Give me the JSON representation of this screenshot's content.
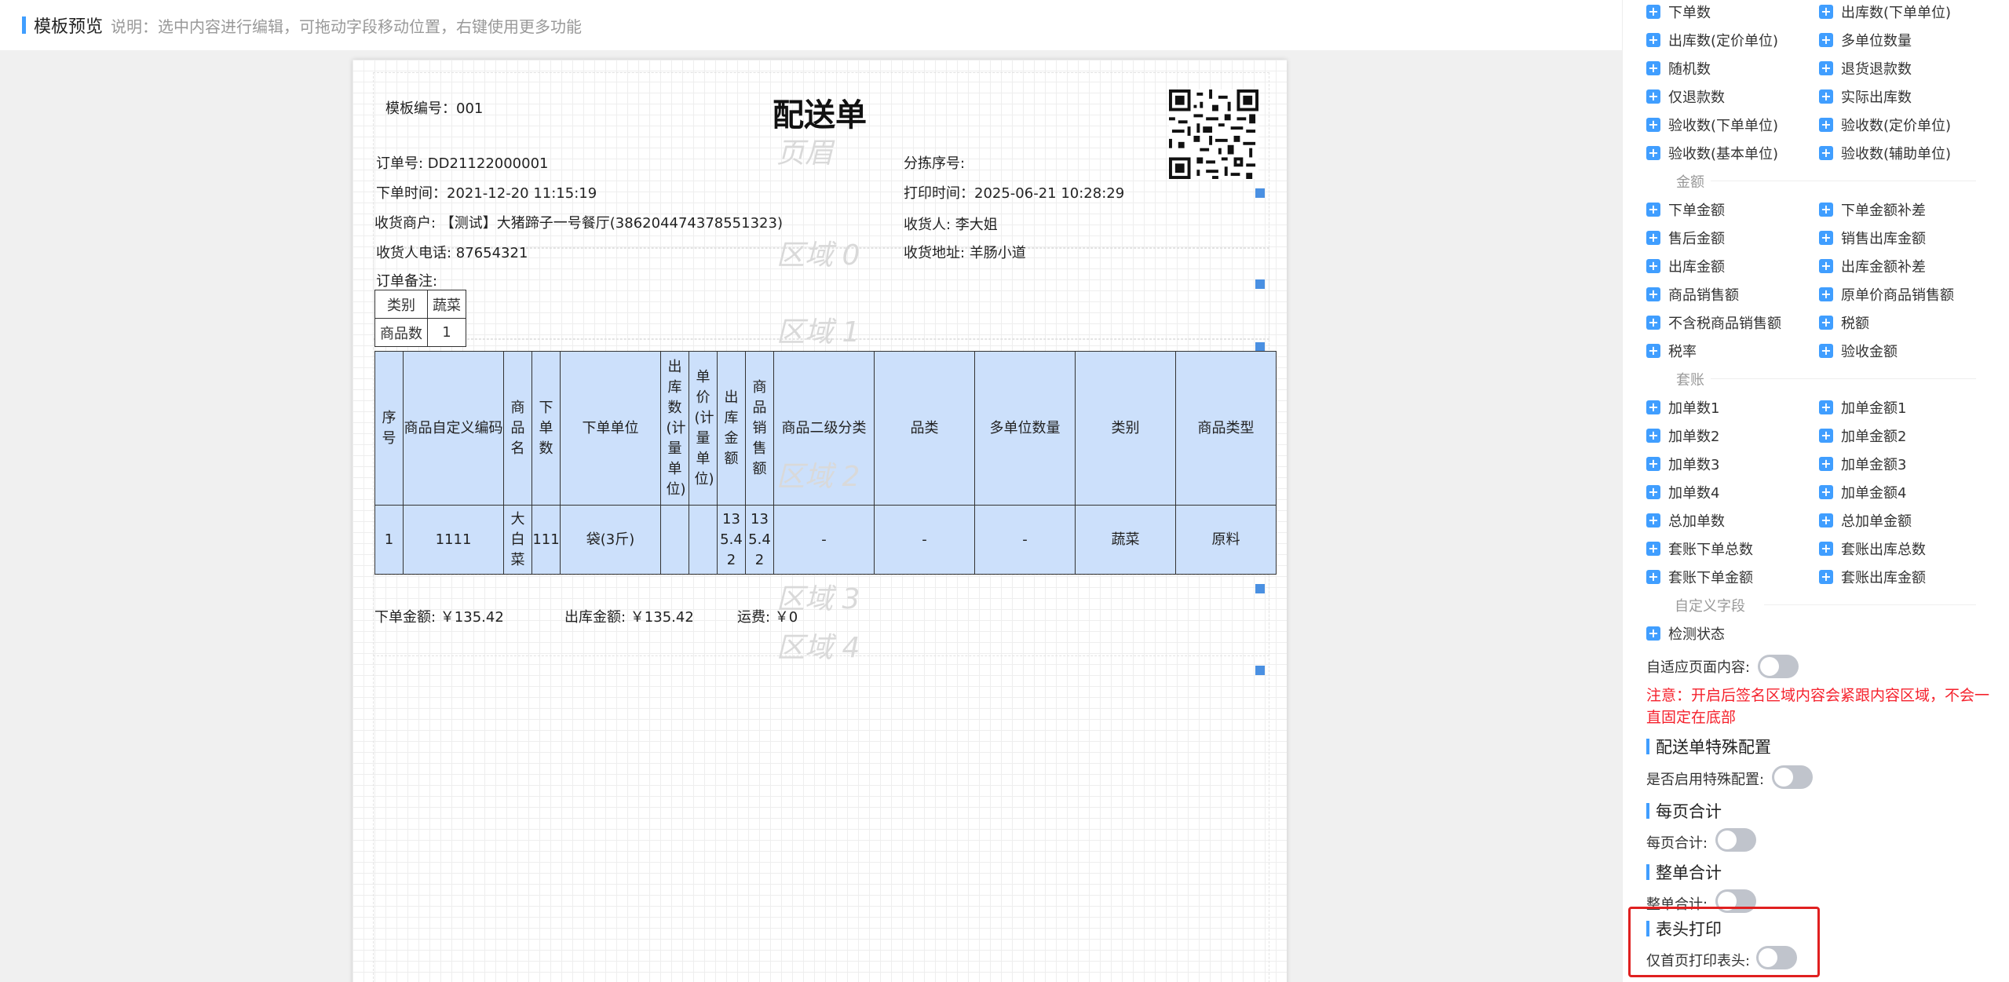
{
  "topbar": {
    "title": "模板预览",
    "desc": "说明：选中内容进行编辑，可拖动字段移动位置，右键使用更多功能"
  },
  "doc": {
    "title": "配送单",
    "template_no": "模板编号：001",
    "order_no": "订单号: DD21122000001",
    "sort_no": "分拣序号:",
    "order_time": "下单时间：2021-12-20 11:15:19",
    "print_time": "打印时间：2025-06-21 10:28:29",
    "merchant": "收货商户: 【测试】大猪蹄子一号餐厅(386204474378551323)",
    "receiver": "收货人: 李大姐",
    "receiver_phone": "收货人电话: 87654321",
    "address": "收货地址: 羊肠小道",
    "remark": "订单备注:",
    "watermarks": {
      "header": "页眉",
      "r0": "区域 0",
      "r1": "区域 1",
      "r2": "区域 2",
      "r3": "区域 3",
      "r4": "区域 4"
    },
    "cat_table": {
      "r1c1": "类别",
      "r1c2": "蔬菜",
      "r2c1": "商品数",
      "r2c2": "1"
    },
    "table": {
      "headers": [
        "序号",
        "商品自定义编码",
        "商品名",
        "下单数",
        "下单单位",
        "出库数(计量单位)",
        "单价(计量单位)",
        "出库金额",
        "商品销售额",
        "商品二级分类",
        "品类",
        "多单位数量",
        "类别",
        "商品类型"
      ],
      "row": [
        "1",
        "1111",
        "大白菜",
        "111",
        "袋(3斤)",
        "",
        "",
        "135.42",
        "135.42",
        "-",
        "-",
        "-",
        "蔬菜",
        "原料"
      ]
    },
    "totals": {
      "order_amount": "下单金额: ￥135.42",
      "out_amount": "出库金额: ￥135.42",
      "freight": "运费: ￥0"
    }
  },
  "panel": {
    "top_fields": [
      "下单数",
      "出库数(下单单位)",
      "出库数(定价单位)",
      "多单位数量",
      "随机数",
      "退货退款数",
      "仅退款数",
      "实际出库数",
      "验收数(下单单位)",
      "验收数(定价单位)",
      "验收数(基本单位)",
      "验收数(辅助单位)"
    ],
    "group_amount": "金额",
    "amount_fields": [
      "下单金额",
      "下单金额补差",
      "售后金额",
      "销售出库金额",
      "出库金额",
      "出库金额补差",
      "商品销售额",
      "原单价商品销售额",
      "不含税商品销售额",
      "税额",
      "税率",
      "验收金额"
    ],
    "group_set": "套账",
    "set_fields": [
      "加单数1",
      "加单金额1",
      "加单数2",
      "加单金额2",
      "加单数3",
      "加单金额3",
      "加单数4",
      "加单金额4",
      "总加单数",
      "总加单金额",
      "套账下单总数",
      "套账出库总数",
      "套账下单金额",
      "套账出库金额"
    ],
    "group_custom": "自定义字段",
    "custom_fields": [
      "检测状态"
    ],
    "adaptive_label": "自适应页面内容:",
    "warning": "注意：开启后签名区域内容会紧跟内容区域，不会一直固定在底部",
    "sec_special": "配送单特殊配置",
    "special_label": "是否启用特殊配置:",
    "sec_page_total": "每页合计",
    "page_total_label": "每页合计:",
    "sec_order_total": "整单合计",
    "order_total_label": "整单合计:",
    "sec_header_print": "表头打印",
    "header_print_label": "仅首页打印表头:"
  }
}
